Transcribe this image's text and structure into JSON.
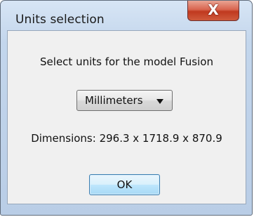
{
  "window": {
    "title": "Units selection",
    "close_glyph": "X",
    "close_icon": "close-icon"
  },
  "dialog": {
    "prompt": "Select units for the model Fusion",
    "units_selected": "Millimeters",
    "dimensions_text": "Dimensions: 296.3 x 1718.9 x 870.9",
    "ok_label": "OK"
  }
}
